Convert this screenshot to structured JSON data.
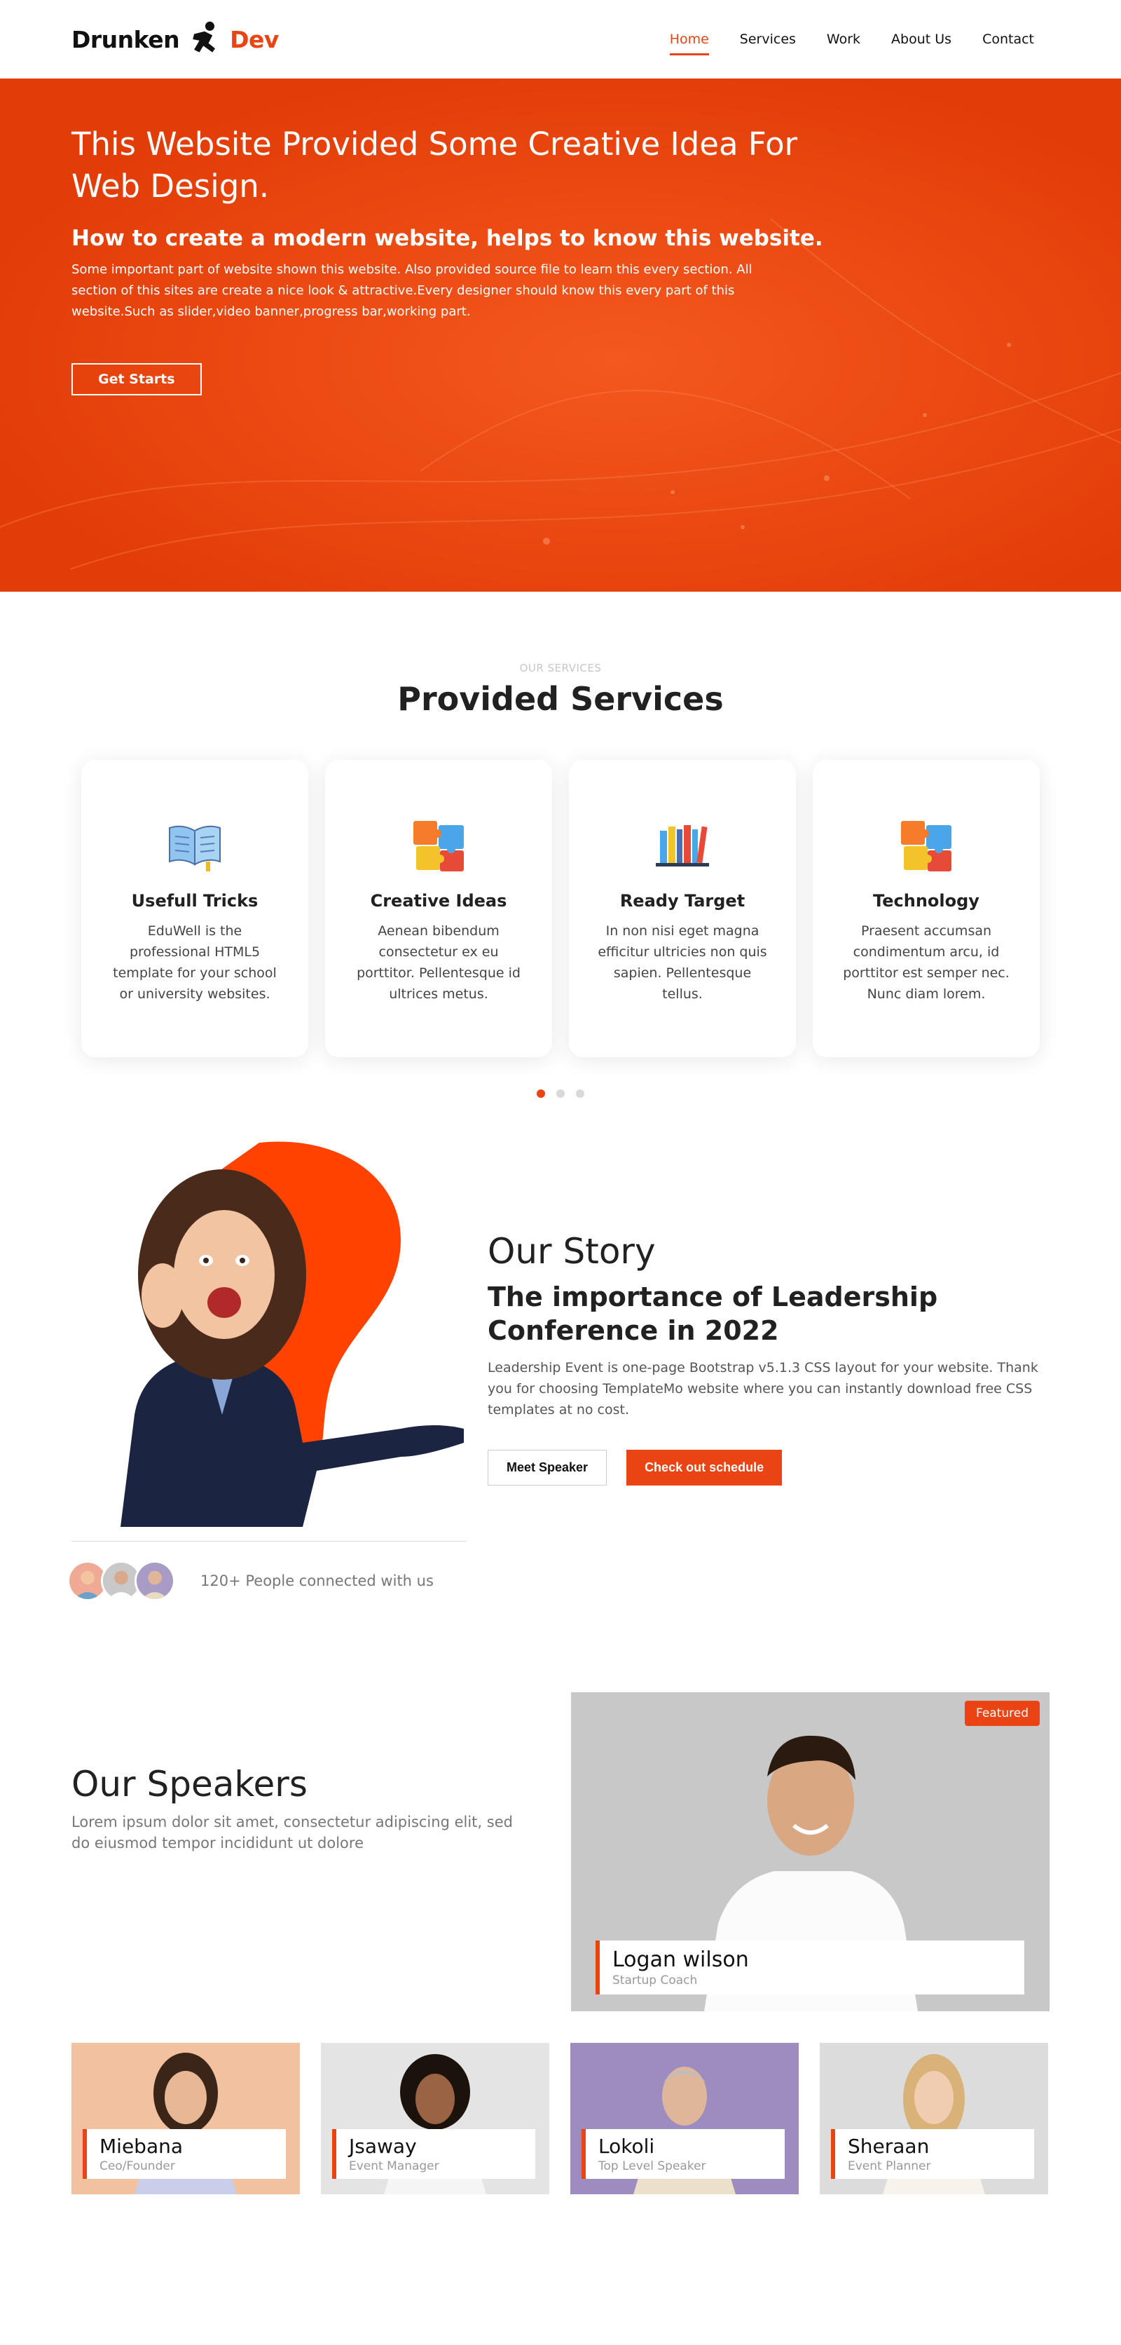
{
  "brand": {
    "word1": "Drunken",
    "word2": "Dev",
    "accent": "#eb4414"
  },
  "nav": {
    "items": [
      {
        "label": "Home",
        "active": true
      },
      {
        "label": "Services"
      },
      {
        "label": "Work"
      },
      {
        "label": "About Us"
      },
      {
        "label": "Contact"
      }
    ]
  },
  "hero": {
    "title": "This Website Provided Some Creative Idea For Web Design.",
    "subtitle": "How to create a modern website, helps to know this website.",
    "body": "Some important part of website shown this website. Also provided source file to learn this every section. All section of this sites are create a nice look & attractive.Every designer should know this every part of this website.Such as slider,video banner,progress bar,working part.",
    "cta": "Get Starts"
  },
  "services": {
    "eyebrow": "OUR SERVICES",
    "title": "Provided Services",
    "cards": [
      {
        "icon": "book-icon",
        "title": "Usefull Tricks",
        "text": "EduWell is the professional HTML5 template for your school or university websites."
      },
      {
        "icon": "puzzle-icon",
        "title": "Creative Ideas",
        "text": "Aenean bibendum consectetur ex eu porttitor. Pellentesque id ultrices metus."
      },
      {
        "icon": "books-icon",
        "title": "Ready Target",
        "text": "In non nisi eget magna efficitur ultricies non quis sapien. Pellentesque tellus."
      },
      {
        "icon": "puzzle-icon",
        "title": "Technology",
        "text": "Praesent accumsan condimentum arcu, id porttitor est semper nec. Nunc diam lorem."
      }
    ],
    "active_dot": 1,
    "dot_count": 3
  },
  "story": {
    "heading": "Our Story",
    "title": "The importance of Leadership Conference in 2022",
    "body": "Leadership Event is one-page Bootstrap v5.1.3 CSS layout for your website. Thank you for choosing TemplateMo website where you can instantly download free CSS templates at no cost.",
    "btn_primary": "Meet Speaker",
    "btn_secondary": "Check out schedule",
    "connected": "120+ People connected with us"
  },
  "speakers": {
    "heading": "Our Speakers",
    "body": "Lorem ipsum dolor sit amet, consectetur adipiscing elit, sed do eiusmod tempor incididunt ut dolore",
    "featured": {
      "badge": "Featured",
      "name": "Logan wilson",
      "role": "Startup Coach"
    },
    "list": [
      {
        "name": "Miebana",
        "role": "Ceo/Founder"
      },
      {
        "name": "Jsaway",
        "role": "Event Manager"
      },
      {
        "name": "Lokoli",
        "role": "Top Level Speaker"
      },
      {
        "name": "Sheraan",
        "role": "Event Planner"
      }
    ]
  }
}
